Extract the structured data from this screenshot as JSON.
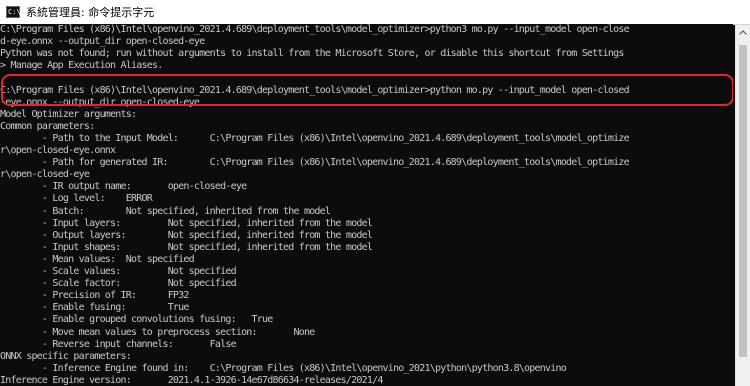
{
  "window": {
    "title": "系統管理員: 命令提示字元",
    "icon": "cmd-icon",
    "icon_glyph": "C:\\"
  },
  "console": {
    "lines": [
      "C:\\Program Files (x86)\\Intel\\openvino_2021.4.689\\deployment_tools\\model_optimizer>python3 mo.py --input_model open-close",
      "d-eye.onnx --output_dir open-closed-eye",
      "Python was not found; run without arguments to install from the Microsoft Store, or disable this shortcut from Settings",
      "> Manage App Execution Aliases.",
      "",
      "C:\\Program Files (x86)\\Intel\\openvino_2021.4.689\\deployment_tools\\model_optimizer>python mo.py --input_model open-closed",
      "-eye.onnx --output_dir open-closed-eye",
      "Model Optimizer arguments:",
      "Common parameters:",
      "        - Path to the Input Model:      C:\\Program Files (x86)\\Intel\\openvino_2021.4.689\\deployment_tools\\model_optimize",
      "r\\open-closed-eye.onnx",
      "        - Path for generated IR:        C:\\Program Files (x86)\\Intel\\openvino_2021.4.689\\deployment_tools\\model_optimize",
      "r\\open-closed-eye",
      "        - IR output name:       open-closed-eye",
      "        - Log level:    ERROR",
      "        - Batch:        Not specified, inherited from the model",
      "        - Input layers:         Not specified, inherited from the model",
      "        - Output layers:        Not specified, inherited from the model",
      "        - Input shapes:         Not specified, inherited from the model",
      "        - Mean values:  Not specified",
      "        - Scale values:         Not specified",
      "        - Scale factor:         Not specified",
      "        - Precision of IR:      FP32",
      "        - Enable fusing:        True",
      "        - Enable grouped convolutions fusing:   True",
      "        - Move mean values to preprocess section:       None",
      "        - Reverse input channels:       False",
      "ONNX specific parameters:",
      "        - Inference Engine found in:    C:\\Program Files (x86)\\Intel\\openvino_2021\\python\\python3.8\\openvino",
      "Inference Engine version:       2021.4.1-3926-14e67d86634-releases/2021/4"
    ]
  },
  "annotation": {
    "highlight_color": "#e0272b",
    "highlighted_lines": [
      5,
      6
    ]
  },
  "scrollbar": {
    "up_arrow_icon": "chevron-up-icon",
    "scroll_position": 0.97
  }
}
